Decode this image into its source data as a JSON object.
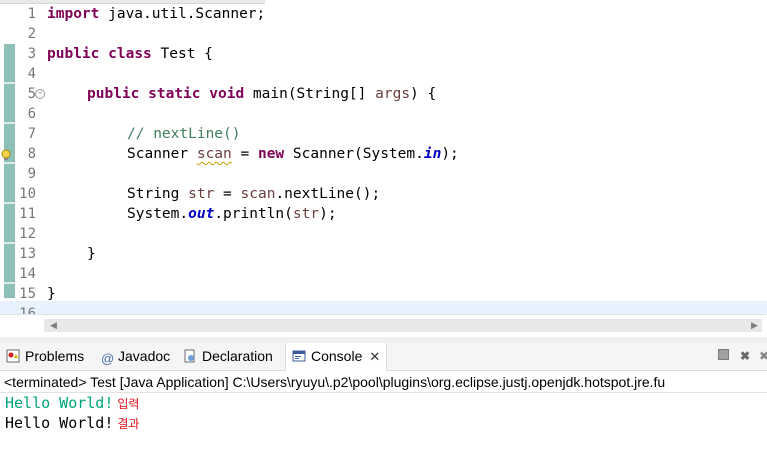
{
  "editor": {
    "line_numbers": [
      "1",
      "2",
      "3",
      "4",
      "5",
      "6",
      "7",
      "8",
      "9",
      "10",
      "11",
      "12",
      "13",
      "14",
      "15",
      "16"
    ],
    "code": {
      "l1_kw": "import",
      "l1_rest": " java.util.Scanner;",
      "l3_kw1": "public",
      "l3_kw2": "class",
      "l3_rest": " Test {",
      "l5_kw1": "public",
      "l5_kw2": "static",
      "l5_kw3": "void",
      "l5_a": " main(String[] ",
      "l5_var": "args",
      "l5_b": ") {",
      "l7_comment": "// nextLine()",
      "l8_a": "Scanner ",
      "l8_var": "scan",
      "l8_b": " = ",
      "l8_kw": "new",
      "l8_c": " Scanner(System.",
      "l8_fld": "in",
      "l8_d": ");",
      "l10_a": "String ",
      "l10_var": "str",
      "l10_b": " = ",
      "l10_var2": "scan",
      "l10_c": ".nextLine();",
      "l11_a": "System.",
      "l11_fld": "out",
      "l11_b": ".println(",
      "l11_var": "str",
      "l11_c": ");",
      "l13": "}",
      "l15": "}"
    }
  },
  "views": {
    "tabs": [
      {
        "label": "Problems",
        "icon": "problems-icon"
      },
      {
        "label": "Javadoc",
        "icon": "javadoc-icon"
      },
      {
        "label": "Declaration",
        "icon": "declaration-icon"
      },
      {
        "label": "Console",
        "icon": "console-icon"
      }
    ],
    "active_tab": "Console",
    "console_status": "<terminated> Test [Java Application] C:\\Users\\ryuyu\\.p2\\pool\\plugins\\org.eclipse.justj.openjdk.hotspot.jre.fu",
    "output": [
      {
        "text": "Hello World!",
        "note": "입력",
        "color": "#00a47a"
      },
      {
        "text": "Hello World!",
        "note": "결과",
        "color": "#000000"
      }
    ]
  }
}
